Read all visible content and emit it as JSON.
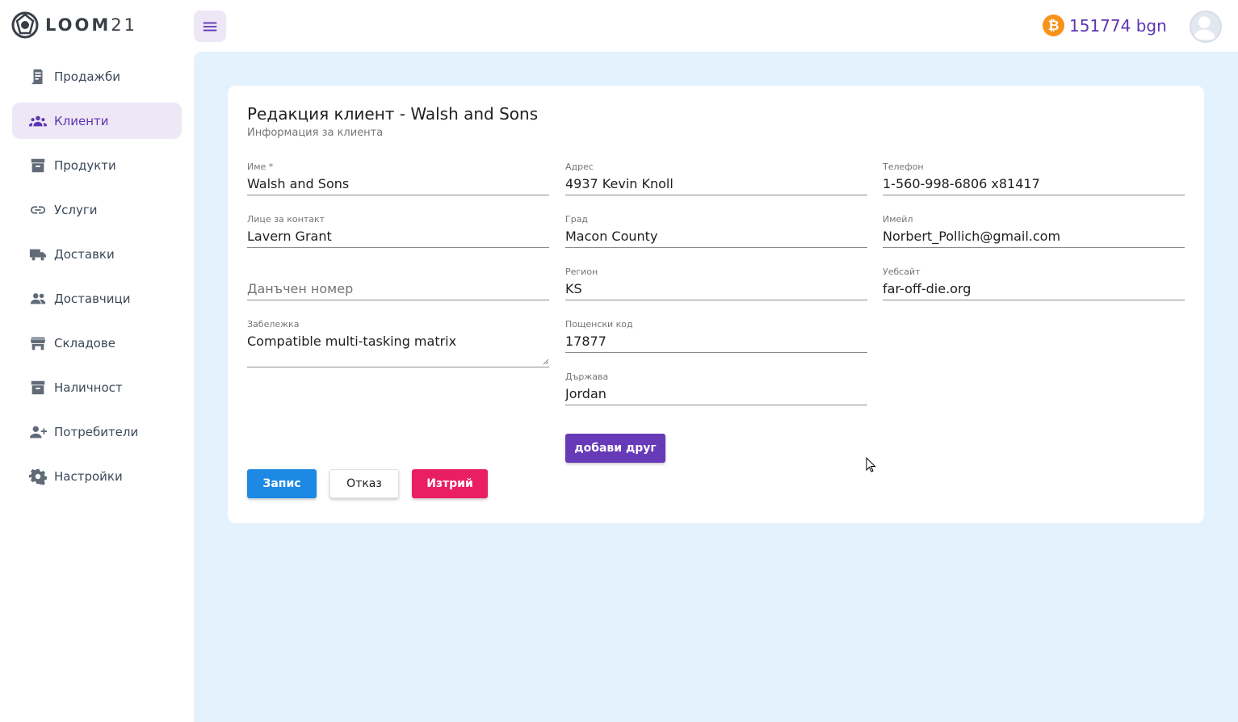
{
  "app": {
    "logo_text": "LOOM",
    "logo_num": "21"
  },
  "sidebar": {
    "items": [
      {
        "label": "Продажби",
        "icon": "receipt-icon",
        "active": false
      },
      {
        "label": "Клиенти",
        "icon": "people-icon",
        "active": true
      },
      {
        "label": "Продукти",
        "icon": "archive-icon",
        "active": false
      },
      {
        "label": "Услуги",
        "icon": "link-icon",
        "active": false
      },
      {
        "label": "Доставки",
        "icon": "truck-icon",
        "active": false
      },
      {
        "label": "Доставчици",
        "icon": "group-icon",
        "active": false
      },
      {
        "label": "Складове",
        "icon": "store-icon",
        "active": false
      },
      {
        "label": "Наличност",
        "icon": "inventory-icon",
        "active": false
      },
      {
        "label": "Потребители",
        "icon": "person-add-icon",
        "active": false
      },
      {
        "label": "Настройки",
        "icon": "gear-icon",
        "active": false
      }
    ]
  },
  "header": {
    "balance": "151774 bgn",
    "btc_symbol": "₿"
  },
  "form": {
    "title": "Редакция клиент - Walsh and Sons",
    "subtitle": "Информация за клиента",
    "name": {
      "label": "Име *",
      "value": "Walsh and Sons"
    },
    "contact": {
      "label": "Лице за контакт",
      "value": "Lavern Grant"
    },
    "tax_number": {
      "label": "",
      "placeholder": "Данъчен номер",
      "value": ""
    },
    "note": {
      "label": "Забележка",
      "value": "Compatible multi-tasking matrix"
    },
    "address": {
      "label": "Адрес",
      "value": "4937 Kevin Knoll"
    },
    "city": {
      "label": "Град",
      "value": "Macon County"
    },
    "region": {
      "label": "Регион",
      "value": "KS"
    },
    "postal_code": {
      "label": "Пощенски код",
      "value": "17877"
    },
    "country": {
      "label": "Държава",
      "value": "Jordan"
    },
    "phone": {
      "label": "Телефон",
      "value": "1-560-998-6806 x81417"
    },
    "email": {
      "label": "Имейл",
      "value": "Norbert_Pollich@gmail.com"
    },
    "website": {
      "label": "Уебсайт",
      "value": "far-off-die.org"
    },
    "add_other_label": "добави друг",
    "save_label": "Запис",
    "cancel_label": "Отказ",
    "delete_label": "Изтрий"
  },
  "colors": {
    "accent": "#5e35b1",
    "accent_light": "#ede7f6",
    "main_bg": "#e3f2fd",
    "save": "#1e88e5",
    "delete": "#e91e63",
    "add": "#673ab7",
    "bitcoin": "#f7931a"
  }
}
